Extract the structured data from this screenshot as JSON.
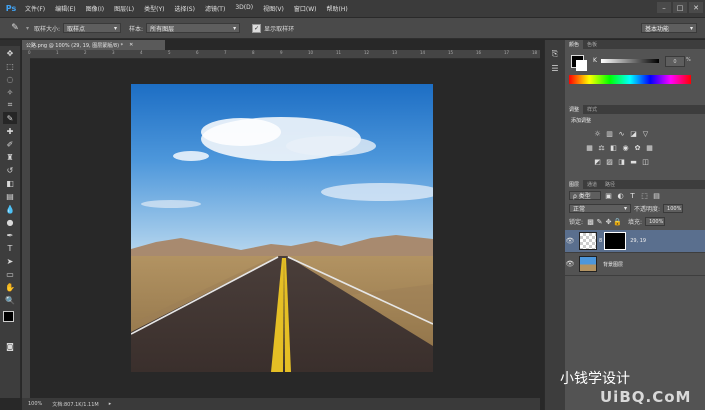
{
  "app": {
    "logo": "Ps"
  },
  "menu": [
    "文件(F)",
    "编辑(E)",
    "图像(I)",
    "图层(L)",
    "类型(Y)",
    "选择(S)",
    "滤镜(T)",
    "3D(D)",
    "视图(V)",
    "窗口(W)",
    "帮助(H)"
  ],
  "window_buttons": [
    "–",
    "□",
    "✕"
  ],
  "options": {
    "sample_size_label": "取样大小:",
    "sample_size_value": "取样点",
    "sample_label": "样本:",
    "sample_value": "所有图层",
    "show_ring_label": "显示取样环",
    "workspace": "基本功能"
  },
  "document": {
    "tab_title": "公路.png @ 100% (29, 19, 图层蒙版/8) *",
    "ruler_ticks": [
      "0",
      "1",
      "2",
      "3",
      "4",
      "5",
      "6",
      "7",
      "8",
      "9",
      "10",
      "11",
      "12",
      "13",
      "14",
      "15",
      "16",
      "17",
      "18"
    ],
    "zoom": "100%",
    "doc_info": "文档:807.1K/1.11M"
  },
  "color_panel": {
    "tabs": [
      "颜色",
      "色板"
    ],
    "channel_label": "K",
    "value": "0",
    "unit": "%"
  },
  "adjustments_panel": {
    "tabs": [
      "调整",
      "样式"
    ],
    "title": "添加调整"
  },
  "layers_panel": {
    "tabs": [
      "图层",
      "通道",
      "路径"
    ],
    "kind_label": "ρ 类型",
    "blend_mode": "正常",
    "opacity_label": "不透明度:",
    "opacity_value": "100%",
    "lock_label": "锁定:",
    "fill_label": "填充:",
    "fill_value": "100%",
    "layers": [
      {
        "name": "29, 19",
        "selected": true
      },
      {
        "name": "背景图层",
        "selected": false
      }
    ]
  },
  "watermark": {
    "line1": "小钱学设计",
    "line2": "UiBQ.CoM"
  },
  "colors": {
    "accent_blue": "#41a3f3",
    "selected_layer": "#5a6f8e"
  }
}
